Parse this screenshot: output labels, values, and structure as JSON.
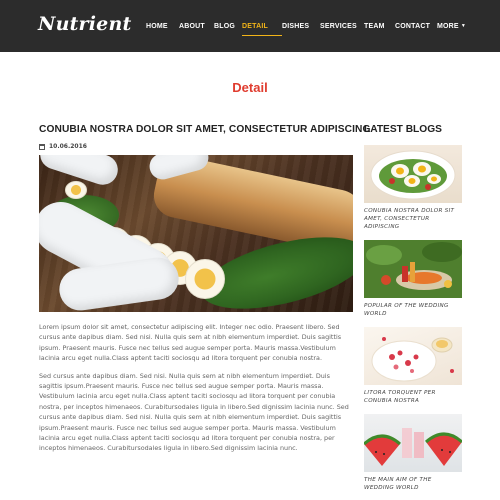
{
  "brand": {
    "logo_text": "Nutrient"
  },
  "nav": {
    "items": [
      {
        "label": "HOME"
      },
      {
        "label": "ABOUT"
      },
      {
        "label": "BLOG"
      },
      {
        "label": "DETAIL",
        "active": true
      },
      {
        "label": "DISHES"
      },
      {
        "label": "SERVICES"
      },
      {
        "label": "TEAM"
      },
      {
        "label": "CONTACT"
      },
      {
        "label": "MORE"
      }
    ]
  },
  "page": {
    "title": "Detail"
  },
  "article": {
    "title": "CONUBIA NOSTRA DOLOR SIT AMET, CONSECTETUR ADIPISCING",
    "date": "10.06.2016",
    "paragraphs": [
      "Lorem ipsum dolor sit amet, consectetur adipiscing elit. Integer nec odio. Praesent libero. Sed cursus ante dapibus diam. Sed nisi. Nulla quis sem at nibh elementum imperdiet. Duis sagittis ipsum. Praesent mauris. Fusce nec tellus sed augue semper porta. Mauris massa.Vestibulum lacinia arcu eget nulla.Class aptent taciti sociosqu ad litora torquent per conubia nostra.",
      "Sed cursus ante dapibus diam. Sed nisi. Nulla quis sem at nibh elementum imperdiet. Duis sagittis ipsum.Praesent mauris. Fusce nec tellus sed augue semper porta. Mauris massa. Vestibulum lacinia arcu eget nulla.Class aptent taciti sociosqu ad litora torquent per conubia nostra, per inceptos himenaeos. Curabitursodales ligula in libero.Sed dignissim lacinia nunc. Sed cursus ante dapibus diam. Sed nisi. Nulla quis sem at nibh elementum imperdiet. Duis sagittis ipsum.Praesent mauris. Fusce nec tellus sed augue semper porta. Mauris massa. Vestibulum lacinia arcu eget nulla.Class aptent taciti sociosqu ad litora torquent per conubia nostra, per inceptos himenaeos. Curabitursodales ligula in libero.Sed dignissim lacinia nunc."
    ]
  },
  "sidebar": {
    "title": "LATEST BLOGS",
    "posts": [
      {
        "caption": "Conubia nostra dolor sit amet, consectetur adipiscing"
      },
      {
        "caption": "Popular of the wedding world"
      },
      {
        "caption": "Litora torquent per conubia nostra"
      },
      {
        "caption": "The main aim of the wedding world"
      }
    ]
  },
  "colors": {
    "header_bg": "#2c2c2c",
    "accent": "#f2b418",
    "title_red": "#e03c2f"
  }
}
